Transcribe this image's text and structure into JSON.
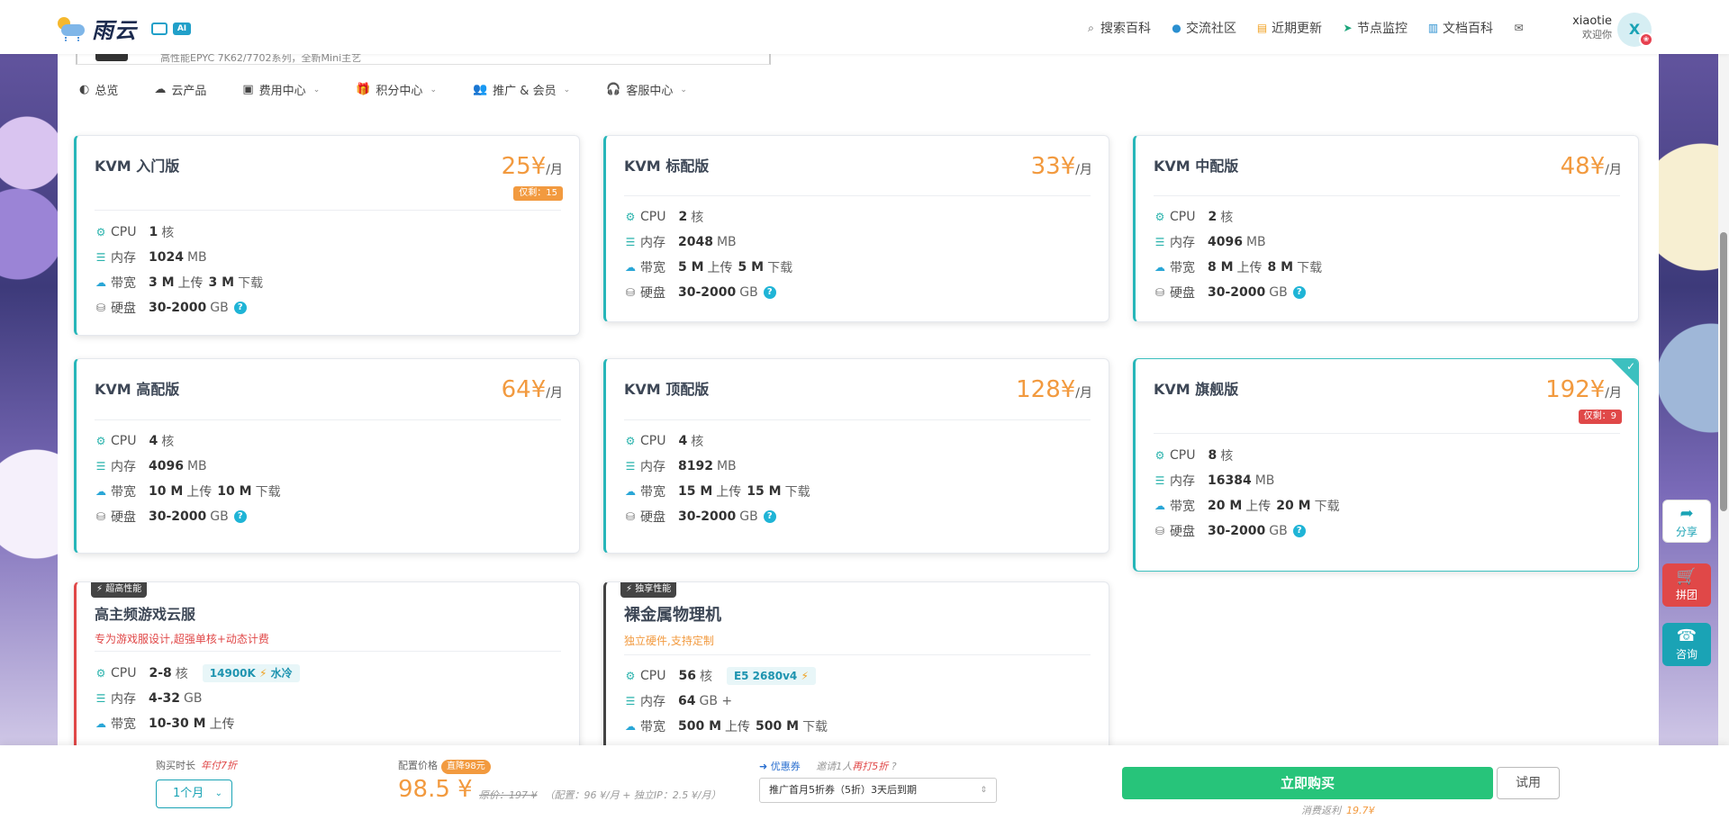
{
  "brand": {
    "name": "雨云",
    "badge2": "AI"
  },
  "topnav": {
    "items": [
      {
        "icon": "⌕",
        "label": "搜索百科"
      },
      {
        "icon": "●",
        "label": "交流社区"
      },
      {
        "icon": "▤",
        "label": "近期更新"
      },
      {
        "icon": "➤",
        "label": "节点监控"
      },
      {
        "icon": "▥",
        "label": "文档百科"
      }
    ],
    "mail_icon": "✉"
  },
  "user": {
    "name": "xiaotie",
    "welcome": "欢迎你",
    "avatar_letter": "X",
    "avatar_dot": "❀"
  },
  "notice": {
    "text": "高性能EPYC 7K62/7702系列，全新Mini主艺"
  },
  "subnav": [
    {
      "icon": "◐",
      "label": "总览"
    },
    {
      "icon": "☁",
      "label": "云产品"
    },
    {
      "icon": "▣",
      "label": "费用中心",
      "chev": "⌄"
    },
    {
      "icon": "🎁",
      "label": "积分中心",
      "chev": "⌄"
    },
    {
      "icon": "👥",
      "label": "推广 & 会员",
      "chev": "⌄"
    },
    {
      "icon": "🎧",
      "label": "客服中心",
      "chev": "⌄"
    }
  ],
  "labels": {
    "cpu": "CPU",
    "mem": "内存",
    "bw": "带宽",
    "disk": "硬盘",
    "core": "核",
    "mb": "MB",
    "gb": "GB",
    "upload": "上传",
    "download": "下载",
    "per_month": "/月",
    "help": "?",
    "check": "✓"
  },
  "plans": [
    {
      "title": "KVM 入门版",
      "price": "25¥",
      "limit": "仅剩：15",
      "cpu": "1",
      "mem": "1024",
      "up": "3 M",
      "down": "3 M",
      "disk": "30-2000"
    },
    {
      "title": "KVM 标配版",
      "price": "33¥",
      "cpu": "2",
      "mem": "2048",
      "up": "5 M",
      "down": "5 M",
      "disk": "30-2000"
    },
    {
      "title": "KVM 中配版",
      "price": "48¥",
      "cpu": "2",
      "mem": "4096",
      "up": "8 M",
      "down": "8 M",
      "disk": "30-2000"
    },
    {
      "title": "KVM 高配版",
      "price": "64¥",
      "cpu": "4",
      "mem": "4096",
      "up": "10 M",
      "down": "10 M",
      "disk": "30-2000"
    },
    {
      "title": "KVM 顶配版",
      "price": "128¥",
      "cpu": "4",
      "mem": "8192",
      "up": "15 M",
      "down": "15 M",
      "disk": "30-2000"
    },
    {
      "title": "KVM 旗舰版",
      "price": "192¥",
      "limit": "仅剩：9",
      "cpu": "8",
      "mem": "16384",
      "up": "20 M",
      "down": "20 M",
      "disk": "30-2000"
    }
  ],
  "specials": [
    {
      "tag": "⚡ 超高性能",
      "title": "高主频游戏云服",
      "desc": "专为游戏服设计,超强单核+动态计费",
      "cpu": "2-8",
      "chip": "14900K",
      "chip_bolt": "⚡",
      "chip_extra": "水冷",
      "mem": "4-32",
      "bw": "10-30 M",
      "bw_mid": "上传"
    },
    {
      "tag": "⚡ 独享性能",
      "title": "裸金属物理机",
      "desc": "独立硬件,支持定制",
      "cpu": "56",
      "chip": "E5 2680v4",
      "chip_bolt": "⚡",
      "mem": "64",
      "mem_extra": "+",
      "up": "500 M",
      "down": "500 M"
    }
  ],
  "side": {
    "share": {
      "icon": "➦",
      "label": "分享"
    },
    "group": {
      "icon": "🛒",
      "label": "拼团"
    },
    "consult": {
      "icon": "☎",
      "label": "咨询"
    }
  },
  "bottom": {
    "duration_label": "购买时长",
    "duration_hint": "年付7折",
    "duration_value": "1个月",
    "chev": "⌄",
    "price_label": "配置价格",
    "save_badge": "直降98元",
    "price": "98.5 ¥",
    "original": "原价：197 ¥",
    "detail": "（配置：96 ¥/月 + 独立IP：2.5 ¥/月）",
    "coupon_icon": "➜",
    "coupon_title": "优惠券",
    "coupon_note_a": "邀请1人",
    "coupon_note_b": "再打5折",
    "coupon_note_q": "?",
    "coupon_value": "推广首月5折券（5折）3天后到期",
    "coupon_arrow": "⇕",
    "buy": "立即购买",
    "trial": "试用",
    "rebate_label": "消费返利",
    "rebate_value": "19.7¥"
  }
}
